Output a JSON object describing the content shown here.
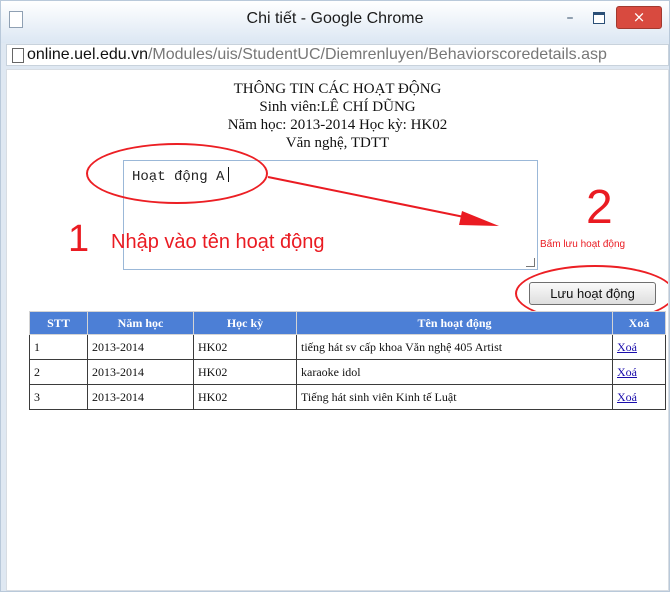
{
  "window": {
    "title": "Chi tiết - Google Chrome",
    "minimize_glyph": "–",
    "close_glyph": "×",
    "page_icon": "page-icon"
  },
  "address": {
    "domain": "online.uel.edu.vn",
    "path": "/Modules/uis/StudentUC/Diemrenluyen/Behaviorscoredetails.asp"
  },
  "header": {
    "title": "THÔNG TIN CÁC HOẠT ĐỘNG",
    "student": "Sinh viên:LÊ CHÍ DŨNG",
    "term": "Năm học: 2013-2014 Học kỳ: HK02",
    "category": "Văn nghệ, TDTT"
  },
  "form": {
    "activity_input_value": "Hoạt động A",
    "save_button_label": "Lưu hoạt động"
  },
  "annotations": {
    "step1_number": "1",
    "step1_text": "Nhập vào tên hoạt động",
    "step2_number": "2",
    "step2_text": "Bấm lưu hoạt động",
    "color": "#ea1b22"
  },
  "table": {
    "headers": [
      "STT",
      "Năm học",
      "Học kỳ",
      "Tên hoạt động",
      "Xoá"
    ],
    "rows": [
      {
        "stt": "1",
        "year": "2013-2014",
        "term": "HK02",
        "name": "tiếng hát sv cấp khoa Văn nghệ 405 Artist",
        "delete": "Xoá"
      },
      {
        "stt": "2",
        "year": "2013-2014",
        "term": "HK02",
        "name": "karaoke idol",
        "delete": "Xoá"
      },
      {
        "stt": "3",
        "year": "2013-2014",
        "term": "HK02",
        "name": "Tiếng hát sinh viên Kinh tế Luật",
        "delete": "Xoá"
      }
    ]
  },
  "colors": {
    "header_bg": "#4c7fd6",
    "close_button": "#d84a3f",
    "link": "#1a0dab"
  }
}
